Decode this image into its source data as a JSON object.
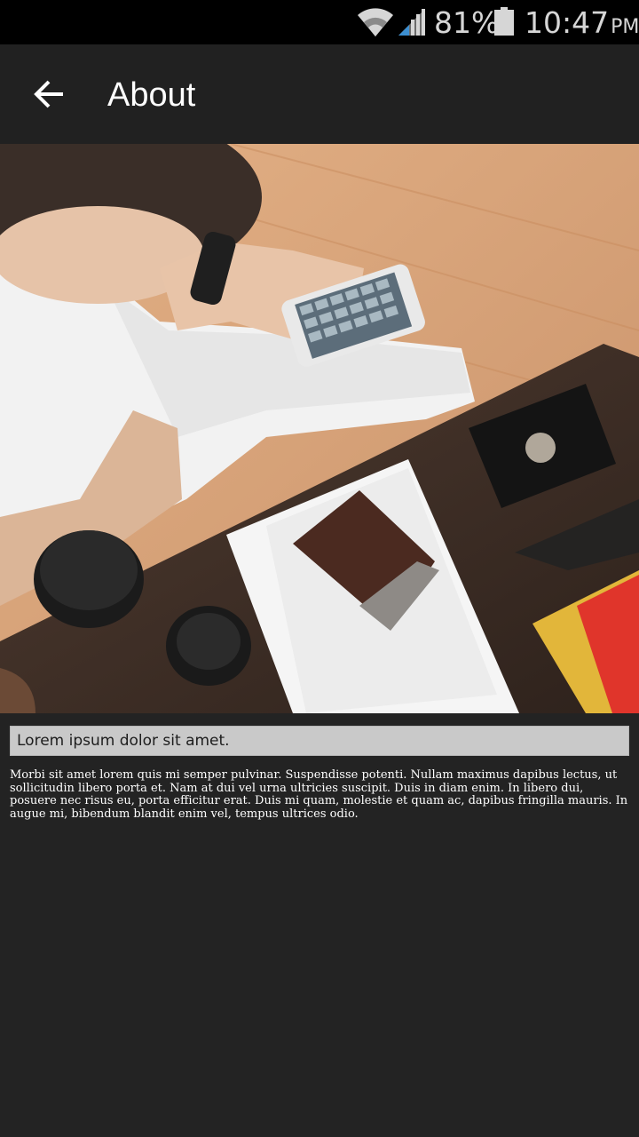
{
  "status_bar": {
    "battery_percent": "81%",
    "time": "10:47",
    "ampm": "PM",
    "icons": [
      "wifi-icon",
      "signal-icon",
      "battery-icon"
    ]
  },
  "app_bar": {
    "title": "About",
    "back_icon": "arrow-back-icon"
  },
  "hero": {
    "description_icon": "photo"
  },
  "content": {
    "heading": "Lorem ipsum dolor sit amet.",
    "body": "Morbi sit amet lorem quis mi semper pulvinar. Suspendisse potenti. Nullam maximus dapibus lectus, ut sollicitudin libero porta et. Nam at dui vel urna ultricies suscipit. Duis in diam enim. In libero dui, posuere nec risus eu, porta efficitur erat. Duis mi quam, molestie et quam ac, dapibus fringilla mauris. In augue mi, bibendum blandit enim vel, tempus ultrices odio."
  },
  "colors": {
    "background": "#232323",
    "app_bar": "#212121",
    "status_bar": "#000000",
    "heading_bg": "#c9c9c9"
  }
}
